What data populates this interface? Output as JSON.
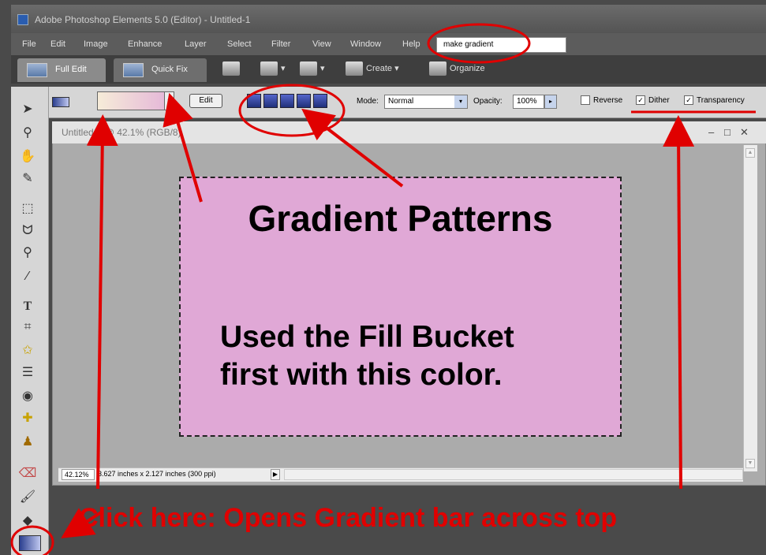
{
  "window": {
    "title": "Adobe Photoshop Elements 5.0 (Editor) - Untitled-1"
  },
  "menu": {
    "items": [
      "File",
      "Edit",
      "Image",
      "Enhance",
      "Layer",
      "Select",
      "Filter",
      "View",
      "Window",
      "Help"
    ],
    "help_search_value": "make gradient"
  },
  "modes": {
    "full_edit": "Full Edit",
    "quick_fix": "Quick Fix",
    "create": "Create",
    "organize": "Organize"
  },
  "options": {
    "edit_label": "Edit",
    "mode_label": "Mode:",
    "mode_value": "Normal",
    "opacity_label": "Opacity:",
    "opacity_value": "100%",
    "reverse_label": "Reverse",
    "reverse_checked": false,
    "dither_label": "Dither",
    "dither_checked": true,
    "transparency_label": "Transparency",
    "transparency_checked": true,
    "gradient_types": [
      "linear",
      "radial",
      "angle",
      "reflected",
      "diamond"
    ]
  },
  "document": {
    "title": "Untitled-1 @ 42.1% (RGB/8)",
    "zoom": "42.12%",
    "info": "3.627 inches x 2.127 inches (300 ppi)"
  },
  "canvas": {
    "title": "Gradient Patterns",
    "line1": "Used the Fill Bucket",
    "line2": "first with this color.",
    "fill_color": "#e0a8d6"
  },
  "annotation": {
    "bottom_text": "Click here: Opens Gradient bar across top",
    "color": "#e00000"
  },
  "tools": [
    "move-tool",
    "zoom-tool",
    "hand-tool",
    "eyedropper-tool",
    "marquee-tool",
    "lasso-tool",
    "magic-wand-tool",
    "brush-selection-tool",
    "type-tool",
    "crop-tool",
    "cookie-cutter-tool",
    "straighten-tool",
    "red-eye-tool",
    "healing-brush-tool",
    "clone-stamp-tool",
    "eraser-tool",
    "brush-tool",
    "paint-bucket-tool",
    "gradient-tool"
  ]
}
